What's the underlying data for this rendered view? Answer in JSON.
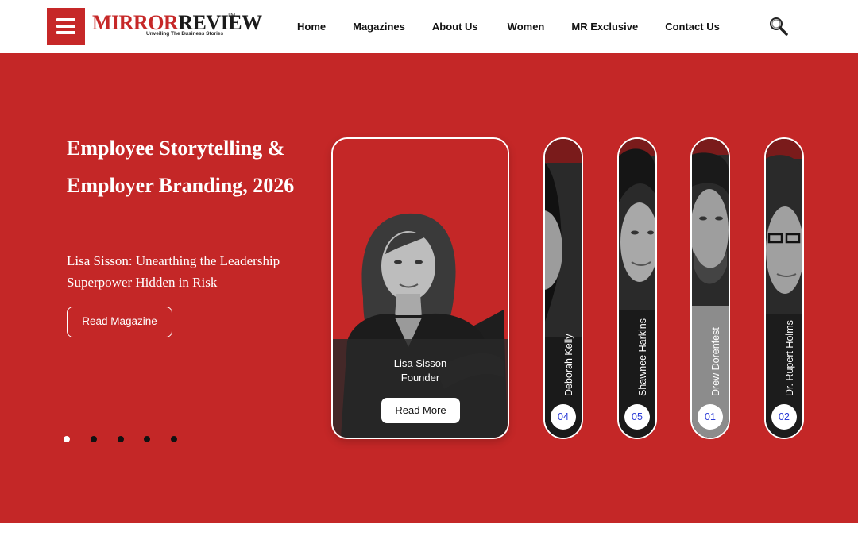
{
  "header": {
    "logo": {
      "mirror": "MIRROR",
      "review": "REVIEW",
      "tm": "TM",
      "tagline": "Unveiling The Business Stories"
    },
    "menu_icon": "hamburger-icon",
    "nav": [
      {
        "label": "Home"
      },
      {
        "label": "Magazines"
      },
      {
        "label": "About Us"
      },
      {
        "label": "Women"
      },
      {
        "label": "MR Exclusive"
      },
      {
        "label": "Contact Us"
      }
    ],
    "search_icon": "search-icon"
  },
  "hero": {
    "title": "Employee Storytelling & Employer Branding, 2026",
    "subtitle": "Lisa Sisson: Unearthing the Leadership Superpower Hidden in Risk",
    "cta_label": "Read Magazine",
    "carousel": {
      "slide_count": 5,
      "active_index": 0
    },
    "featured": {
      "name": "Lisa Sisson",
      "role": "Founder",
      "button_label": "Read More"
    },
    "cards": [
      {
        "name": "Deborah Kelly",
        "number": "04"
      },
      {
        "name": "Shawnee Harkins",
        "number": "05"
      },
      {
        "name": "Drew Dorenfest",
        "number": "01"
      },
      {
        "name": "Dr. Rupert Holms",
        "number": "02"
      }
    ]
  },
  "colors": {
    "brand_red": "#c42727",
    "number_blue": "#2b3bd6",
    "text_dark": "#111111"
  }
}
